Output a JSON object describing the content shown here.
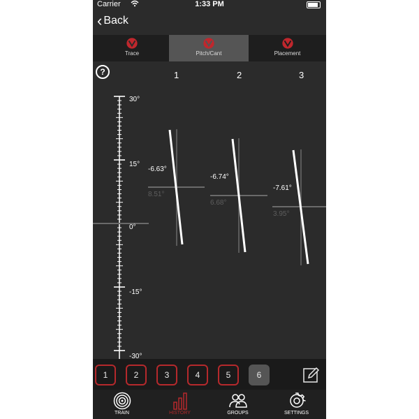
{
  "status": {
    "carrier": "Carrier",
    "time": "1:33 PM"
  },
  "nav": {
    "back_label": "Back"
  },
  "tabs": [
    {
      "label": "Trace",
      "active": false
    },
    {
      "label": "Pitch/Cant",
      "active": true
    },
    {
      "label": "Placement",
      "active": false
    }
  ],
  "columns": [
    "1",
    "2",
    "3"
  ],
  "ruler": {
    "labels": [
      "30°",
      "15°",
      "0°",
      "-15°",
      "-30°"
    ]
  },
  "shots": [
    {
      "cant": "-6.63°",
      "pitch": "8.51°"
    },
    {
      "cant": "-6.74°",
      "pitch": "6.68°"
    },
    {
      "cant": "-7.61°",
      "pitch": "3.95°"
    }
  ],
  "shot_buttons": [
    "1",
    "2",
    "3",
    "4",
    "5",
    "6"
  ],
  "active_shot": "6",
  "tabbar": [
    {
      "label": "TRAIN",
      "icon": "target-icon"
    },
    {
      "label": "HISTORY",
      "icon": "bar-chart-icon",
      "active": true
    },
    {
      "label": "GROUPS",
      "icon": "users-icon"
    },
    {
      "label": "SETTINGS",
      "icon": "gear-icon"
    }
  ],
  "colors": {
    "accent": "#b5292c",
    "background": "#2b2b2b",
    "active_segment": "#555555"
  }
}
